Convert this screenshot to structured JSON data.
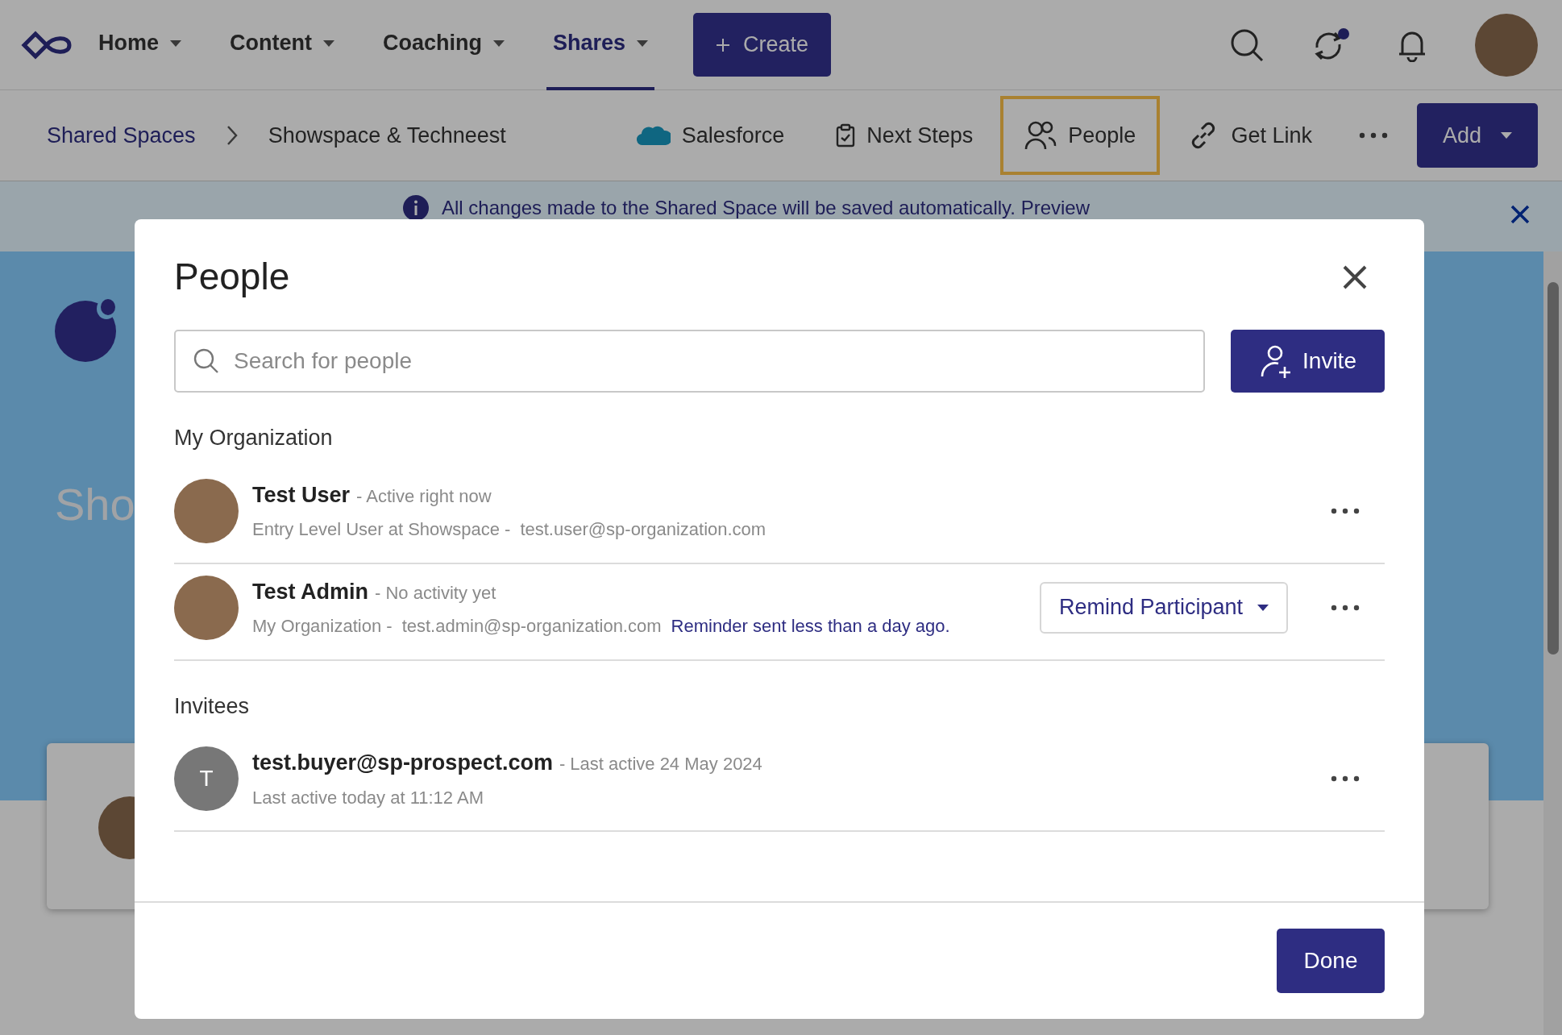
{
  "top_nav": {
    "items": [
      {
        "label": "Home",
        "selected": false
      },
      {
        "label": "Content",
        "selected": false
      },
      {
        "label": "Coaching",
        "selected": false
      },
      {
        "label": "Shares",
        "selected": true
      }
    ],
    "create_button": "Create"
  },
  "breadcrumb": [
    "Shared Spaces",
    "Showspace & Techneest"
  ],
  "toolbar": {
    "items": [
      {
        "label": "Salesforce",
        "kind": "salesforce",
        "selected": false
      },
      {
        "label": "Next Steps",
        "kind": "clipboard",
        "selected": false
      },
      {
        "label": "People",
        "kind": "people",
        "selected": true
      },
      {
        "label": "Get Link",
        "kind": "link",
        "selected": false
      }
    ],
    "add_button": "Add"
  },
  "banner": {
    "text": "All changes made to the Shared Space will be saved automatically.",
    "link": "Preview"
  },
  "background": {
    "title": "Sho"
  },
  "dialog": {
    "title": "People",
    "search": {
      "placeholder": "Search for people"
    },
    "invite_button": "Invite",
    "sections": [
      {
        "heading": "My Organization",
        "people": [
          {
            "name": "Test User",
            "activity": "- Active right now",
            "details": "Entry Level User at Showspace -",
            "email": "test.user@sp-organization.com",
            "avatar": {
              "kind": "photo"
            }
          },
          {
            "name": "Test Admin",
            "activity": "- No activity yet",
            "details": "My Organization -",
            "email": "test.admin@sp-organization.com",
            "note": "Reminder sent less than a day ago.",
            "action": "Remind Participant",
            "avatar": {
              "kind": "photo"
            }
          }
        ]
      },
      {
        "heading": "Invitees",
        "people": [
          {
            "name": "test.buyer@sp-prospect.com",
            "activity": "- Last active 24 May 2024",
            "details": "Last active today at 11:12 AM",
            "avatar": {
              "kind": "initial",
              "text": "T"
            }
          }
        ]
      }
    ],
    "done_button": "Done"
  }
}
